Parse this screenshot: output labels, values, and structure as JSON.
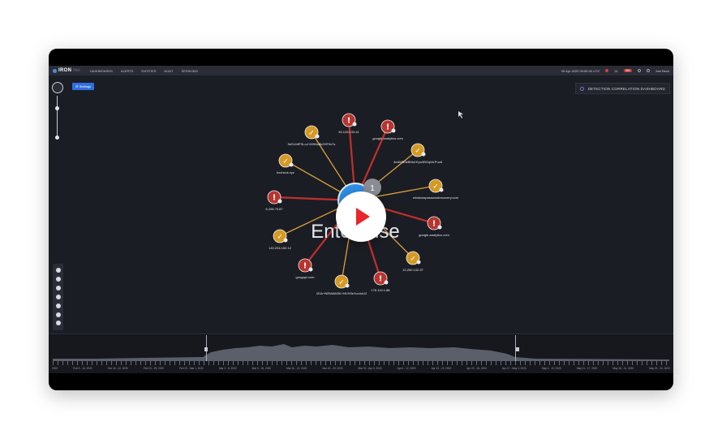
{
  "app": {
    "logo_main": "IRON",
    "logo_sub": "Net",
    "nav": [
      "Dashboards",
      "Alerts",
      "Entities",
      "Hunt",
      "Sessions"
    ],
    "datetime": "09 Apr 2020 09:55:40 UTC",
    "alert_count_red": "21",
    "alert_count_pill": "360",
    "user": "Joel Beck"
  },
  "graph": {
    "settings_label": "☰ Settings",
    "dashboard_label": "DETECTION CORRELATION DASHBOARD",
    "center_label": "Enterprise",
    "center_count": "1",
    "nodes": [
      {
        "label": "45.128.133.41",
        "status": "alert"
      },
      {
        "label": "google-analytics.com",
        "status": "alert"
      },
      {
        "label": "4eAWB0kBMs1Epu3BGqMLPuc8",
        "status": "ok"
      },
      {
        "label": "windowspasswordrecovery.com",
        "status": "ok"
      },
      {
        "label": "google-analytics.com",
        "status": "alert"
      },
      {
        "label": "13.250.102.97",
        "status": "ok"
      },
      {
        "label": "176.119.1.88",
        "status": "alert"
      },
      {
        "label": "IZUk+NRWAM3K+NVH3sYun4uU2",
        "status": "ok"
      },
      {
        "label": "googapi.com",
        "status": "alert"
      },
      {
        "label": "143.204.160.12",
        "status": "ok"
      },
      {
        "label": "8.208.79.87",
        "status": "alert"
      },
      {
        "label": "bxcheck.xyz",
        "status": "ok"
      },
      {
        "label": "5eSLNtPSLo4+M9Nu8kZHF9z7s",
        "status": "ok"
      }
    ]
  },
  "timeline": {
    "labels": [
      "2020",
      "Feb 9 - 15, 2020",
      "Feb 16 - 22, 2020",
      "Feb 23 - 29, 2020",
      "Feb 23 - Mar 1, 2020",
      "Mar 2 - 8, 2020",
      "Mar 9 - 15, 2020",
      "Mar 16 - 22, 2020",
      "Mar 23 - 29, 2020",
      "Mar 30 - Apr 5, 2020",
      "Apr 6 - 12, 2020",
      "Apr 13 - 19, 2020",
      "Apr 20 - 26, 2020",
      "Apr 27 - May 3, 2020",
      "May 4 - 10, 2020",
      "May 11 - 17, 2020",
      "May 18 - 24, 2020",
      "May 20 - 24, 2020"
    ]
  },
  "colors": {
    "alert": "#b8342f",
    "ok": "#d49a24",
    "alert_edge": "#c0302c",
    "ok_edge": "#d9a03a",
    "center": "#2e8fe6"
  }
}
